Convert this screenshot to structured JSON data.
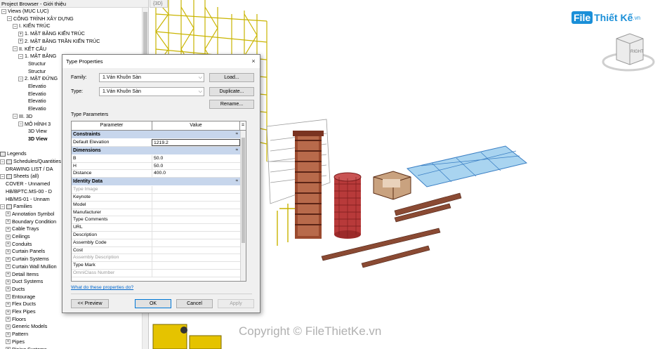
{
  "project_browser": {
    "title": "Project Browser - Giới thiệu",
    "nodes": [
      {
        "label": "Views (MỤC LỤC)",
        "toggle": "−"
      },
      {
        "label": "CÔNG TRÌNH XÂY DỰNG",
        "toggle": "−"
      },
      {
        "label": "I. KIẾN TRÚC",
        "toggle": "−"
      },
      {
        "label": "1. MẶT BẰNG KIẾN TRÚC",
        "toggle": "+"
      },
      {
        "label": "2. MẶT BẰNG TRẦN KIẾN TRÚC",
        "toggle": "+"
      },
      {
        "label": "II. KẾT CẤU",
        "toggle": "−"
      },
      {
        "label": "1. MẶT BẰNG",
        "toggle": "−"
      },
      {
        "label": "Structur",
        "toggle": ""
      },
      {
        "label": "Structur",
        "toggle": ""
      },
      {
        "label": "2. MẶT ĐỨNG",
        "toggle": "−"
      },
      {
        "label": "Elevatio",
        "toggle": ""
      },
      {
        "label": "Elevatio",
        "toggle": ""
      },
      {
        "label": "Elevatio",
        "toggle": ""
      },
      {
        "label": "Elevatio",
        "toggle": ""
      },
      {
        "label": "III. 3D",
        "toggle": "−"
      },
      {
        "label": "MÔ HÌNH 3",
        "toggle": "−"
      },
      {
        "label": "3D View",
        "toggle": ""
      },
      {
        "label": "3D View",
        "toggle": ""
      },
      {
        "label": "",
        "toggle": ""
      },
      {
        "label": "Legends",
        "toggle": ""
      },
      {
        "label": "Schedules/Quantities",
        "toggle": "−"
      },
      {
        "label": "DRAWING LIST / DA",
        "toggle": ""
      },
      {
        "label": "Sheets (all)",
        "toggle": "−"
      },
      {
        "label": "COVER - Unnamed",
        "toggle": ""
      },
      {
        "label": "HB/BPTC.MS-00 - D",
        "toggle": ""
      },
      {
        "label": "HB/MS-01 - Unnam",
        "toggle": ""
      },
      {
        "label": "Families",
        "toggle": "−"
      },
      {
        "label": "Annotation Symbol",
        "toggle": "+"
      },
      {
        "label": "Boundary Condition",
        "toggle": "+"
      },
      {
        "label": "Cable Trays",
        "toggle": "+"
      },
      {
        "label": "Ceilings",
        "toggle": "+"
      },
      {
        "label": "Conduits",
        "toggle": "+"
      },
      {
        "label": "Curtain Panels",
        "toggle": "+"
      },
      {
        "label": "Curtain Systems",
        "toggle": "+"
      },
      {
        "label": "Curtain Wall Mullion",
        "toggle": "+"
      },
      {
        "label": "Detail Items",
        "toggle": "+"
      },
      {
        "label": "Duct Systems",
        "toggle": "+"
      },
      {
        "label": "Ducts",
        "toggle": "+"
      },
      {
        "label": "Entourage",
        "toggle": "+"
      },
      {
        "label": "Flex Ducts",
        "toggle": "+"
      },
      {
        "label": "Flex Pipes",
        "toggle": "+"
      },
      {
        "label": "Floors",
        "toggle": "+"
      },
      {
        "label": "Generic Models",
        "toggle": "+"
      },
      {
        "label": "Pattern",
        "toggle": "+"
      },
      {
        "label": "Pipes",
        "toggle": "+"
      },
      {
        "label": "Piping Systems",
        "toggle": "+"
      }
    ]
  },
  "view": {
    "tab_label": "{3D}",
    "viewcube_label": "RIGHT",
    "logo_badge": "File",
    "logo_text": "Thiết Kế",
    "logo_suffix": ".vn",
    "watermark": "Copyright © FileThietKe.vn"
  },
  "dialog": {
    "title": "Type Properties",
    "close_glyph": "×",
    "family_label": "Family:",
    "family_value": "1.Ván Khuôn Sàn",
    "type_label": "Type:",
    "type_value": "1.Ván Khuôn Sàn",
    "load_button": "Load...",
    "duplicate_button": "Duplicate...",
    "rename_button": "Rename...",
    "type_parameters_label": "Type Parameters",
    "col_parameter": "Parameter",
    "col_value": "Value",
    "col_equals": "=",
    "groups": [
      {
        "name": "Constraints",
        "rows": [
          {
            "parameter": "Default Elevation",
            "value": "1219.2",
            "editing": true
          }
        ]
      },
      {
        "name": "Dimensions",
        "rows": [
          {
            "parameter": "B",
            "value": "50.0"
          },
          {
            "parameter": "H",
            "value": "50.0"
          },
          {
            "parameter": "Distance",
            "value": "400.0"
          }
        ]
      },
      {
        "name": "Identity Data",
        "rows": [
          {
            "parameter": "Type Image",
            "value": "",
            "grey": true
          },
          {
            "parameter": "Keynote",
            "value": ""
          },
          {
            "parameter": "Model",
            "value": ""
          },
          {
            "parameter": "Manufacturer",
            "value": ""
          },
          {
            "parameter": "Type Comments",
            "value": ""
          },
          {
            "parameter": "URL",
            "value": ""
          },
          {
            "parameter": "Description",
            "value": ""
          },
          {
            "parameter": "Assembly Code",
            "value": ""
          },
          {
            "parameter": "Cost",
            "value": ""
          },
          {
            "parameter": "Assembly Description",
            "value": "",
            "grey": true
          },
          {
            "parameter": "Type Mark",
            "value": ""
          },
          {
            "parameter": "OmniClass Number",
            "value": "",
            "grey": true
          }
        ]
      }
    ],
    "help_link": "What do these properties do?",
    "preview_button": "<< Preview",
    "ok_button": "OK",
    "cancel_button": "Cancel",
    "apply_button": "Apply"
  }
}
